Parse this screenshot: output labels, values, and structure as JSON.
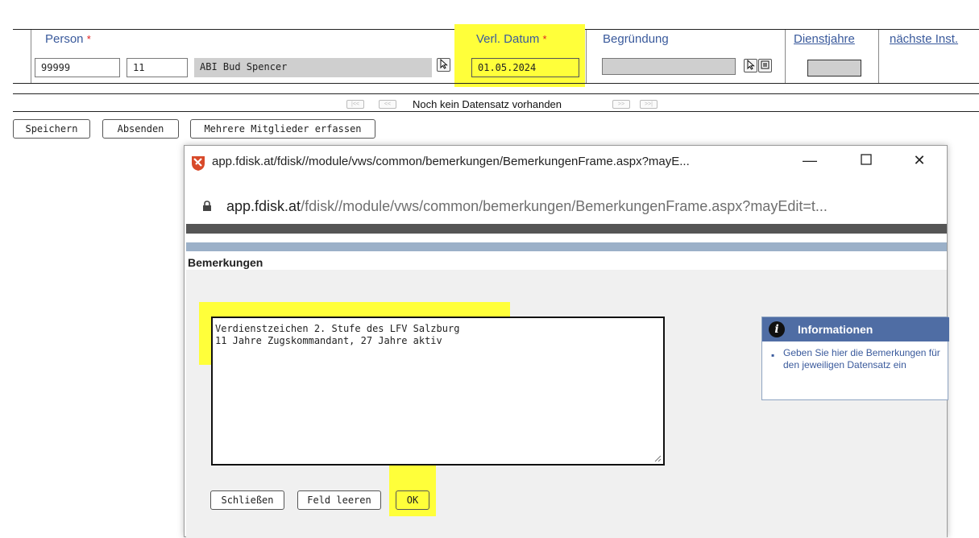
{
  "form": {
    "headers": {
      "person": "Person",
      "verl_datum": "Verl. Datum",
      "begruendung": "Begründung",
      "dienstjahre": "Dienstjahre",
      "naechste_inst": "nächste Inst."
    },
    "required_marker": "*",
    "fields": {
      "person_id": "99999",
      "person_nr": "11",
      "person_name": "ABI Bud Spencer",
      "verl_datum": "01.05.2024",
      "begruendung": "",
      "dienstjahre": ""
    },
    "pager": {
      "status": "Noch kein Datensatz vorhanden",
      "first": "|<<",
      "prev": "<<",
      "next": ">>",
      "last": ">>|"
    },
    "buttons": {
      "speichern": "Speichern",
      "absenden": "Absenden",
      "mehrere": "Mehrere Mitglieder erfassen"
    }
  },
  "popup": {
    "window_title": "app.fdisk.at/fdisk//module/vws/common/bemerkungen/BemerkungenFrame.aspx?mayE...",
    "url_host": "app.fdisk.at",
    "url_path": "/fdisk//module/vws/common/bemerkungen/BemerkungenFrame.aspx?mayEdit=t...",
    "section_title": "Bemerkungen",
    "remarks": "Verdienstzeichen 2. Stufe des LFV Salzburg\n11 Jahre Zugskommandant, 27 Jahre aktiv",
    "info": {
      "title": "Informationen",
      "text": "Geben Sie hier die Bemerkungen für den jeweiligen Datensatz ein"
    },
    "buttons": {
      "schliessen": "Schließen",
      "feld_leeren": "Feld leeren",
      "ok": "OK"
    }
  },
  "colors": {
    "highlight": "#ffff3a",
    "header_link": "#3a5a9c",
    "required": "#e02020",
    "info_header": "#4f6da4"
  }
}
